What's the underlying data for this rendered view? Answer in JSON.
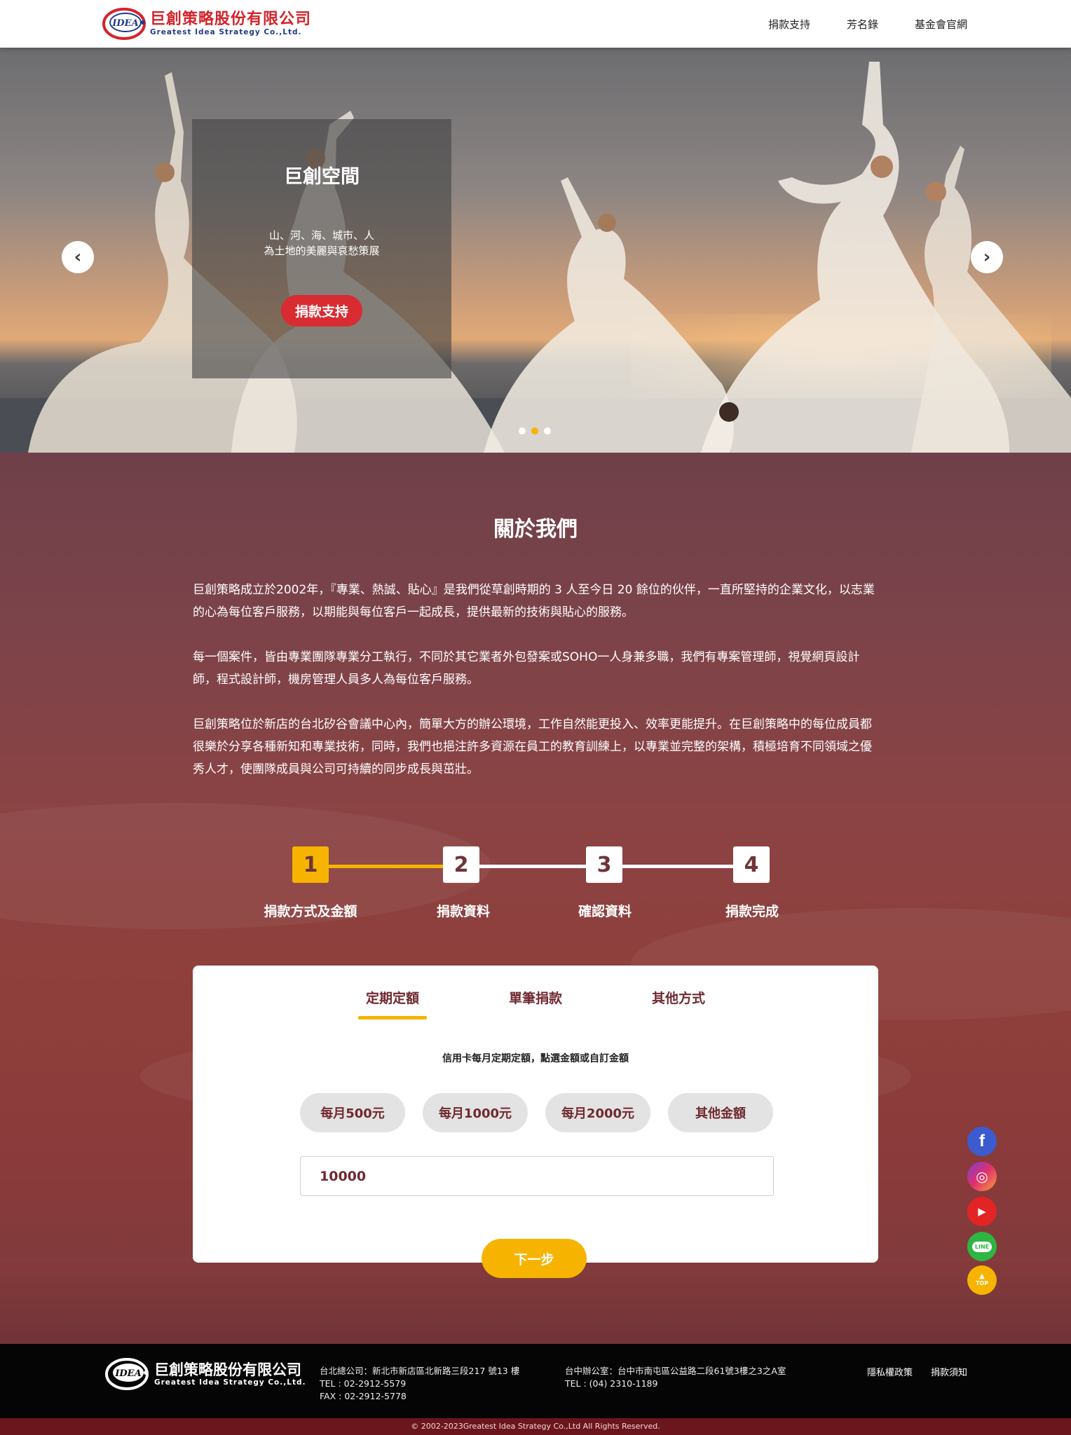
{
  "header": {
    "logo_mark": "IDEA",
    "company_cn": "巨創策略股份有限公司",
    "company_en": "Greatest Idea Strategy Co.,Ltd.",
    "nav": [
      "捐款支持",
      "芳名錄",
      "基金會官網"
    ]
  },
  "hero": {
    "title": "巨創空間",
    "subtitle_line1": "山、河、海、城市、人",
    "subtitle_line2": "為土地的美麗與哀愁策展",
    "button": "捐款支持",
    "prev_icon": "‹",
    "next_icon": "›",
    "slides": 3,
    "active_slide": 2
  },
  "about": {
    "title": "關於我們",
    "paragraphs": [
      "巨創策略成立於2002年，『專業、熱誠、貼心』是我們從草創時期的 3 人至今日 20 餘位的伙伴，一直所堅持的企業文化，以志業的心為每位客戶服務，以期能與每位客戶一起成長，提供最新的技術與貼心的服務。",
      "每一個案件，皆由專業團隊專業分工執行，不同於其它業者外包發案或SOHO一人身兼多職，我們有專案管理師，視覺網頁設計師，程式設計師，機房管理人員多人為每位客戶服務。",
      "巨創策略位於新店的台北矽谷會議中心內，簡單大方的辦公環境，工作自然能更投入、效率更能提升。在巨創策略中的每位成員都很樂於分享各種新知和專業技術，同時，我們也挹注許多資源在員工的教育訓練上，以專業並完整的架構，積極培育不同領域之優秀人才，使團隊成員與公司可持續的同步成長與茁壯。"
    ]
  },
  "steps": [
    {
      "num": "1",
      "label": "捐款方式及金額"
    },
    {
      "num": "2",
      "label": "捐款資料"
    },
    {
      "num": "3",
      "label": "確認資料"
    },
    {
      "num": "4",
      "label": "捐款完成"
    }
  ],
  "donation": {
    "tabs": [
      "定期定額",
      "單筆捐款",
      "其他方式"
    ],
    "active_tab": 0,
    "hint": "信用卡每月定期定額，點選金額或自訂金額",
    "amounts": [
      "每月500元",
      "每月1000元",
      "每月2000元",
      "其他金額"
    ],
    "input_value": "10000",
    "next": "下一步"
  },
  "social": {
    "facebook": "f",
    "instagram": "◎",
    "youtube": "▶",
    "line": "LINE",
    "top_arrow": "▲",
    "top": "TOP"
  },
  "colors": {
    "brand_red": "#d4232b",
    "accent_yellow": "#f6b400",
    "brand_blue": "#1f3a8a",
    "maroon": "#6f2a30"
  },
  "footer": {
    "logo_mark": "IDEA",
    "company_cn": "巨創策略股份有限公司",
    "company_en": "Greatest Idea Strategy Co.,Ltd.",
    "hq_address": "台北總公司：新北市新店區北新路三段217 號13 樓",
    "hq_tel": "TEL : 02-2912-5579",
    "hq_fax": "FAX : 02-2912-5778",
    "tc_address": "台中辦公室：台中市南屯區公益路二段61號3樓之3之A室",
    "tc_tel": "TEL : (04) 2310-1189",
    "links": [
      "隱私權政策",
      "捐款須知"
    ],
    "copyright": "© 2002-2023Greatest Idea Strategy Co.,Ltd All Rights Reserved."
  }
}
